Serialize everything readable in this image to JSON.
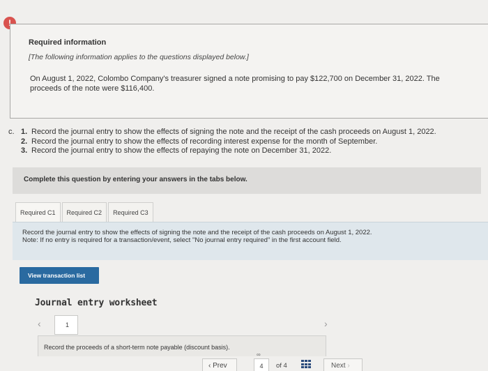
{
  "alert_icon": "exclamation-icon",
  "info": {
    "title": "Required information",
    "subtitle": "[The following information applies to the questions displayed below.]",
    "body": "On August 1, 2022, Colombo Company's treasurer signed a note promising to pay $122,700 on December 31, 2022. The proceeds of the note were $116,400."
  },
  "questions": {
    "letter": "c.",
    "items": [
      {
        "num": "1.",
        "text": "Record the journal entry to show the effects of signing the note and the receipt of the cash proceeds on August 1, 2022."
      },
      {
        "num": "2.",
        "text": "Record the journal entry to show the effects of recording interest expense for the month of September."
      },
      {
        "num": "3.",
        "text": "Record the journal entry to show the effects of repaying the note on December 31, 2022."
      }
    ]
  },
  "complete_label": "Complete this question by entering your answers in the tabs below.",
  "tabs": [
    {
      "label": "Required C1",
      "active": true
    },
    {
      "label": "Required C2",
      "active": false
    },
    {
      "label": "Required C3",
      "active": false
    }
  ],
  "instructions": {
    "line1": "Record the journal entry to show the effects of signing the note and the receipt of the cash proceeds on August 1, 2022.",
    "line2": "Note: If no entry is required for a transaction/event, select \"No journal entry required\" in the first account field."
  },
  "view_button": "View transaction list",
  "worksheet": {
    "title": "Journal entry worksheet",
    "page": "1",
    "entry_description": "Record the proceeds of a short-term note payable (discount basis)."
  },
  "pager": {
    "prev": "Prev",
    "current": "4",
    "of_label": "of 4",
    "next": "Next"
  },
  "colors": {
    "accent": "#2a6aa0",
    "alert": "#d9534f"
  }
}
